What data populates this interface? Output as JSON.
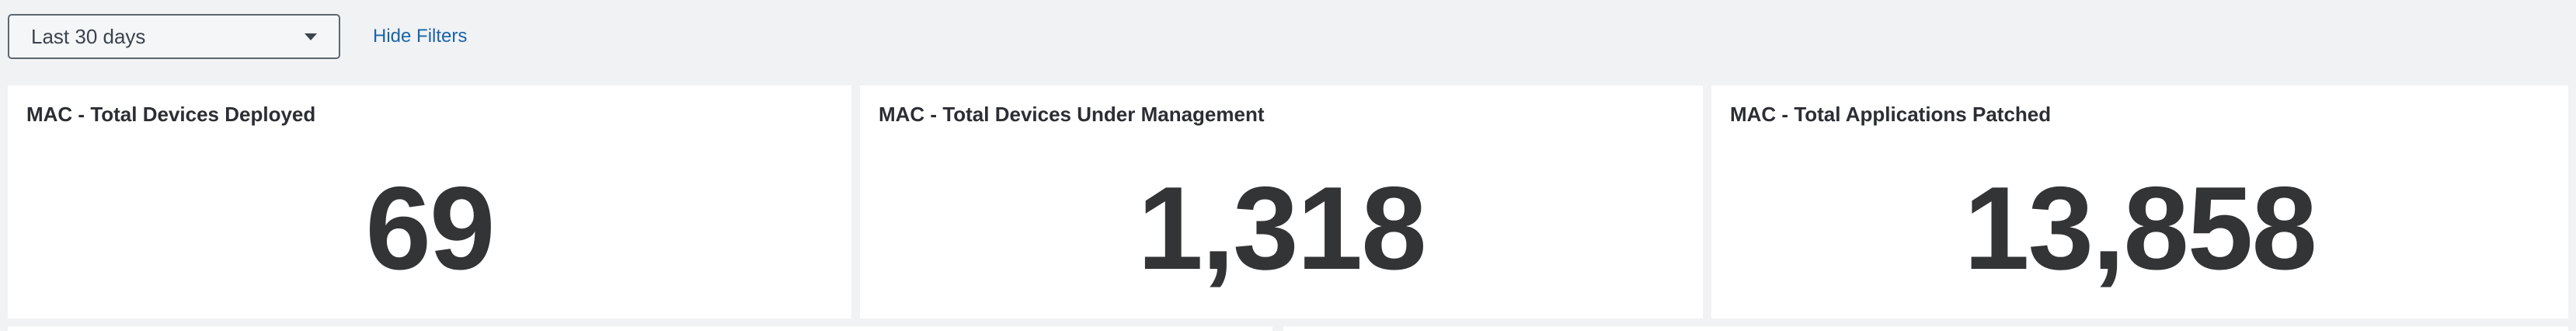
{
  "filters": {
    "time_range": "Last 30 days",
    "hide_filters_label": "Hide Filters"
  },
  "panels": [
    {
      "title": "MAC - Total Devices Deployed",
      "value": "69"
    },
    {
      "title": "MAC - Total Devices Under Management",
      "value": "1,318"
    },
    {
      "title": "MAC - Total Applications Patched",
      "value": "13,858"
    }
  ]
}
